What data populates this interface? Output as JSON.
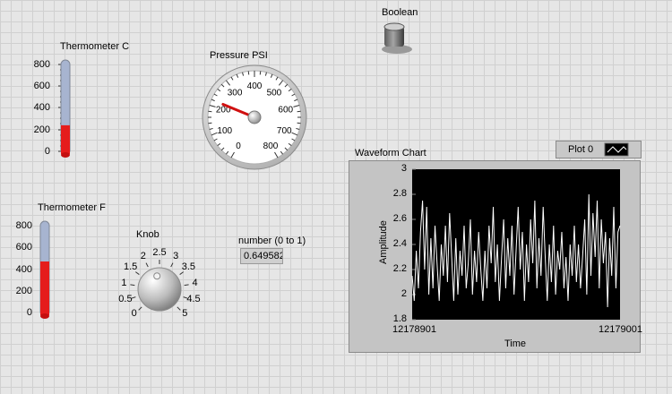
{
  "thermometer_c": {
    "label": "Thermometer C",
    "ticks": [
      "800",
      "600",
      "400",
      "200",
      "0"
    ],
    "scale_max": 800,
    "value": 240
  },
  "thermometer_f": {
    "label": "Thermometer F",
    "ticks": [
      "800",
      "600",
      "400",
      "200",
      "0"
    ],
    "scale_max": 800,
    "value": 470
  },
  "pressure": {
    "label": "Pressure PSI",
    "ticks": [
      "0",
      "100",
      "200",
      "300",
      "400",
      "500",
      "600",
      "700",
      "800"
    ],
    "scale_max": 800,
    "value": 220
  },
  "boolean": {
    "label": "Boolean"
  },
  "knob": {
    "label": "Knob",
    "ticks": [
      "0",
      "0.5",
      "1",
      "1.5",
      "2",
      "2.5",
      "3",
      "3.5",
      "4",
      "4.5",
      "5"
    ],
    "scale_max": 5,
    "value": 2.3
  },
  "number": {
    "label": "number (0 to 1)",
    "value": "0.649582"
  },
  "waveform": {
    "title": "Waveform Chart",
    "legend_label": "Plot 0",
    "y_label": "Amplitude",
    "x_label": "Time",
    "y_ticks": [
      "3",
      "2.8",
      "2.6",
      "2.4",
      "2.2",
      "2",
      "1.8"
    ],
    "x_start": "12178901",
    "x_end": "12179001"
  },
  "colors": {
    "red_fill": "#e51c1c",
    "tube_empty": "#a7b4d0",
    "plot_bg": "#000000",
    "plot_line": "#ffffff",
    "needle": "#d01010"
  },
  "chart_data": {
    "type": "line",
    "title": "Waveform Chart",
    "xlabel": "Time",
    "ylabel": "Amplitude",
    "xlim": [
      12178901,
      12179001
    ],
    "ylim": [
      1.8,
      3
    ],
    "series": [
      {
        "name": "Plot 0",
        "x_start": 12178901,
        "x_step": 1,
        "values": [
          2.15,
          1.95,
          2.35,
          2.05,
          2.5,
          2.75,
          2.2,
          2.7,
          2.0,
          2.45,
          2.05,
          2.55,
          2.25,
          1.95,
          2.4,
          2.15,
          2.55,
          2.1,
          2.65,
          2.3,
          1.95,
          2.45,
          2.0,
          2.35,
          2.15,
          2.55,
          2.05,
          2.25,
          2.6,
          2.0,
          2.35,
          2.1,
          2.5,
          2.2,
          1.95,
          2.35,
          2.05,
          2.55,
          2.25,
          2.7,
          2.1,
          2.4,
          1.95,
          2.3,
          2.6,
          2.05,
          2.45,
          2.15,
          2.55,
          2.0,
          2.35,
          2.7,
          2.2,
          2.5,
          1.95,
          2.4,
          2.1,
          2.6,
          2.25,
          2.75,
          2.05,
          2.45,
          2.15,
          2.7,
          2.3,
          1.95,
          2.4,
          2.1,
          2.55,
          2.0,
          2.35,
          2.2,
          2.5,
          2.05,
          2.3,
          1.95,
          2.4,
          2.15,
          2.55,
          2.1,
          2.4,
          2.05,
          2.3,
          2.6,
          2.0,
          2.8,
          2.15,
          2.65,
          2.3,
          2.75,
          2.05,
          2.6,
          2.25,
          2.5,
          1.9,
          2.45,
          2.15,
          2.7,
          2.05,
          2.5,
          2.55
        ]
      }
    ]
  }
}
